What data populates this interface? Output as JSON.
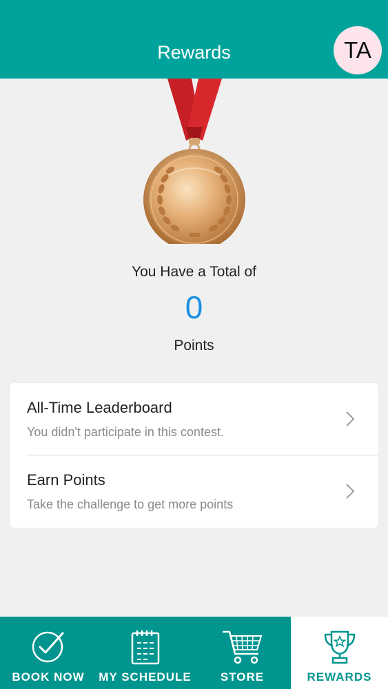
{
  "header": {
    "title": "Rewards",
    "avatar_initials": "TA"
  },
  "summary": {
    "label": "You Have a Total of",
    "points": "0",
    "unit": "Points"
  },
  "menu": [
    {
      "title": "All-Time Leaderboard",
      "subtitle": "You didn't participate in this contest."
    },
    {
      "title": "Earn Points",
      "subtitle": "Take the challenge to get more points"
    }
  ],
  "tabs": [
    {
      "label": "BOOK NOW",
      "icon": "check-circle-icon"
    },
    {
      "label": "MY SCHEDULE",
      "icon": "calendar-icon"
    },
    {
      "label": "STORE",
      "icon": "cart-icon"
    },
    {
      "label": "REWARDS",
      "icon": "trophy-icon",
      "active": true
    }
  ],
  "colors": {
    "header": "#00a39b",
    "tabbar": "#00958e",
    "points": "#1a8fe3",
    "avatar_bg": "#fde3ec",
    "ribbon": "#d32a2a",
    "medal": "#d49a5e"
  }
}
